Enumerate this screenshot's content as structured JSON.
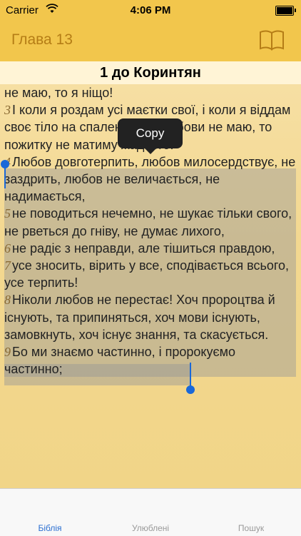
{
  "status": {
    "carrier": "Carrier",
    "time": "4:06 PM"
  },
  "nav": {
    "chapter": "Глава 13"
  },
  "header": {
    "title": "1 до Коринтян"
  },
  "text": {
    "line0": "не маю, то я ніщо!",
    "v3_num": "3",
    "v3": "І коли я роздам усі маєтки свої, і коли я віддам своє тіло на спалення, та любови не маю, то пожитку не матиму жадного!",
    "v4_num": "4",
    "v4": "Любов довготерпить, любов милосердствує, не заздрить, любов не величається, не надимається,",
    "v5_num": "5",
    "v5": "не поводиться нечемно, не шукає тільки свого, не рветься до гніву, не думає лихого,",
    "v6_num": "6",
    "v6": "не радіє з неправди, але тішиться правдою,",
    "v7_num": "7",
    "v7": "усе зносить, вірить у все, сподівається всього, усе терпить!",
    "v8_num": "8",
    "v8": "Ніколи любов не перестає! Хоч пророцтва й існують, та припиняться, хоч мови існують, замовкнуть, хоч існує знання, та скасується.",
    "v9_num": "9",
    "v9": "Бо ми знаємо частинно, і пророкуємо частинно;"
  },
  "popup": {
    "copy_label": "Copy"
  },
  "tabs": [
    {
      "label": "Біблія"
    },
    {
      "label": "Улюблені"
    },
    {
      "label": "Пошук"
    }
  ],
  "colors": {
    "accent": "#f2c64c",
    "active_tab": "#2c6fd1",
    "selection_handle": "#1a68d8"
  }
}
